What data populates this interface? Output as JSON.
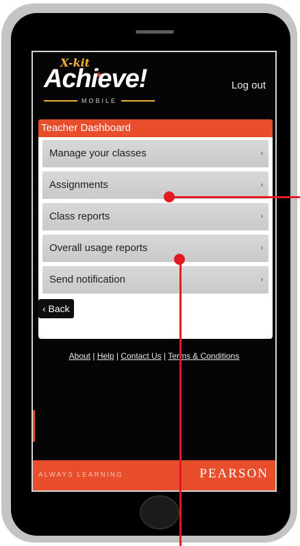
{
  "logo": {
    "xkit": "X-kit",
    "brand": "Achieve!",
    "sub": "MOBILE"
  },
  "header": {
    "logout_label": "Log out"
  },
  "dashboard": {
    "title": "Teacher Dashboard",
    "items": [
      {
        "label": "Manage your classes"
      },
      {
        "label": "Assignments"
      },
      {
        "label": "Class reports"
      },
      {
        "label": "Overall usage reports"
      },
      {
        "label": "Send notification"
      }
    ],
    "chevron": "›",
    "back_label": "‹ Back"
  },
  "footer": {
    "links": [
      "About",
      "Help",
      "Contact Us",
      "Terms & Conditions"
    ],
    "separator": "|"
  },
  "bottom_bar": {
    "tagline": "ALWAYS LEARNING",
    "brand": "PEARSON"
  },
  "colors": {
    "accent": "#e84d2c",
    "callout": "#e21b23",
    "menu_bg": "#d0d0d0"
  }
}
